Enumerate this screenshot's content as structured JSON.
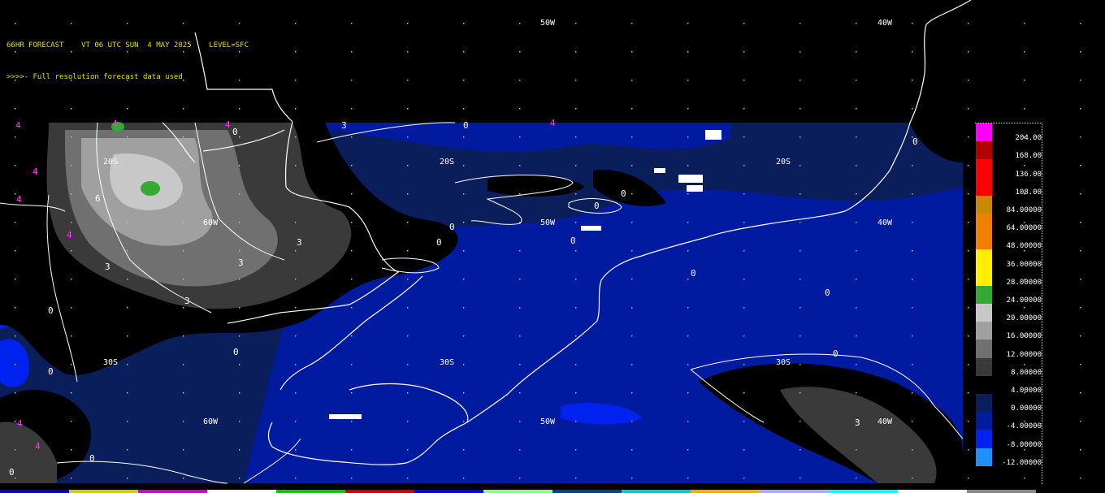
{
  "header": {
    "line1": "66HR FORECAST    VT 06 UTC SUN  4 MAY 2025    LEVEL=SFC",
    "line2": ">>>>- Full resolution forecast data used"
  },
  "grid_labels": {
    "lon_50w": "50W",
    "lon_40w": "40W",
    "lon_60w": "60W",
    "lat_20s": "20S",
    "lat_30s": "30S"
  },
  "contour_labels": {
    "zero": "0",
    "three": "3",
    "four": "4",
    "six": "6"
  },
  "legend": {
    "levels": [
      {
        "label": "204.00",
        "color": "#ff00ff"
      },
      {
        "label": "168.00",
        "color": "#b00000"
      },
      {
        "label": "136.00",
        "color": "#ff0000"
      },
      {
        "label": "108.00",
        "color": "#ff0000"
      },
      {
        "label": "84.00000",
        "color": "#c88800"
      },
      {
        "label": "64.00000",
        "color": "#f08000"
      },
      {
        "label": "48.00000",
        "color": "#f08000"
      },
      {
        "label": "36.00000",
        "color": "#ffee00"
      },
      {
        "label": "28.00000",
        "color": "#ffee00"
      },
      {
        "label": "24.00000",
        "color": "#33aa33"
      },
      {
        "label": "20.00000",
        "color": "#c8c8c8"
      },
      {
        "label": "16.00000",
        "color": "#a0a0a0"
      },
      {
        "label": "12.00000",
        "color": "#707070"
      },
      {
        "label": "8.00000",
        "color": "#3a3a3a"
      },
      {
        "label": "4.00000",
        "color": "#000000"
      },
      {
        "label": "0.00000",
        "color": "#0a1e5c"
      },
      {
        "label": "-4.00000",
        "color": "#001aa0"
      },
      {
        "label": "-8.00000",
        "color": "#0022ee"
      },
      {
        "label": "-12.00000",
        "color": "#1e90ff"
      }
    ]
  },
  "colors": {
    "header_text": "#e8e000",
    "coastline": "#ffffff",
    "label_magenta": "#ff33ff",
    "negative_fill": "#001aa0",
    "deep_negative_fill": "#0022ee",
    "gray_fill": "#3a3a3a"
  },
  "bottom_strip_colors": [
    "#0000cc",
    "#cccc00",
    "#cc00cc",
    "#ffffff",
    "#00cc00",
    "#cc0000",
    "#0000ff",
    "#88ff88",
    "#004488",
    "#00cccc",
    "#ffaa00",
    "#aaaaff",
    "#00ffff",
    "#ffffff",
    "#888888",
    "#000000"
  ]
}
